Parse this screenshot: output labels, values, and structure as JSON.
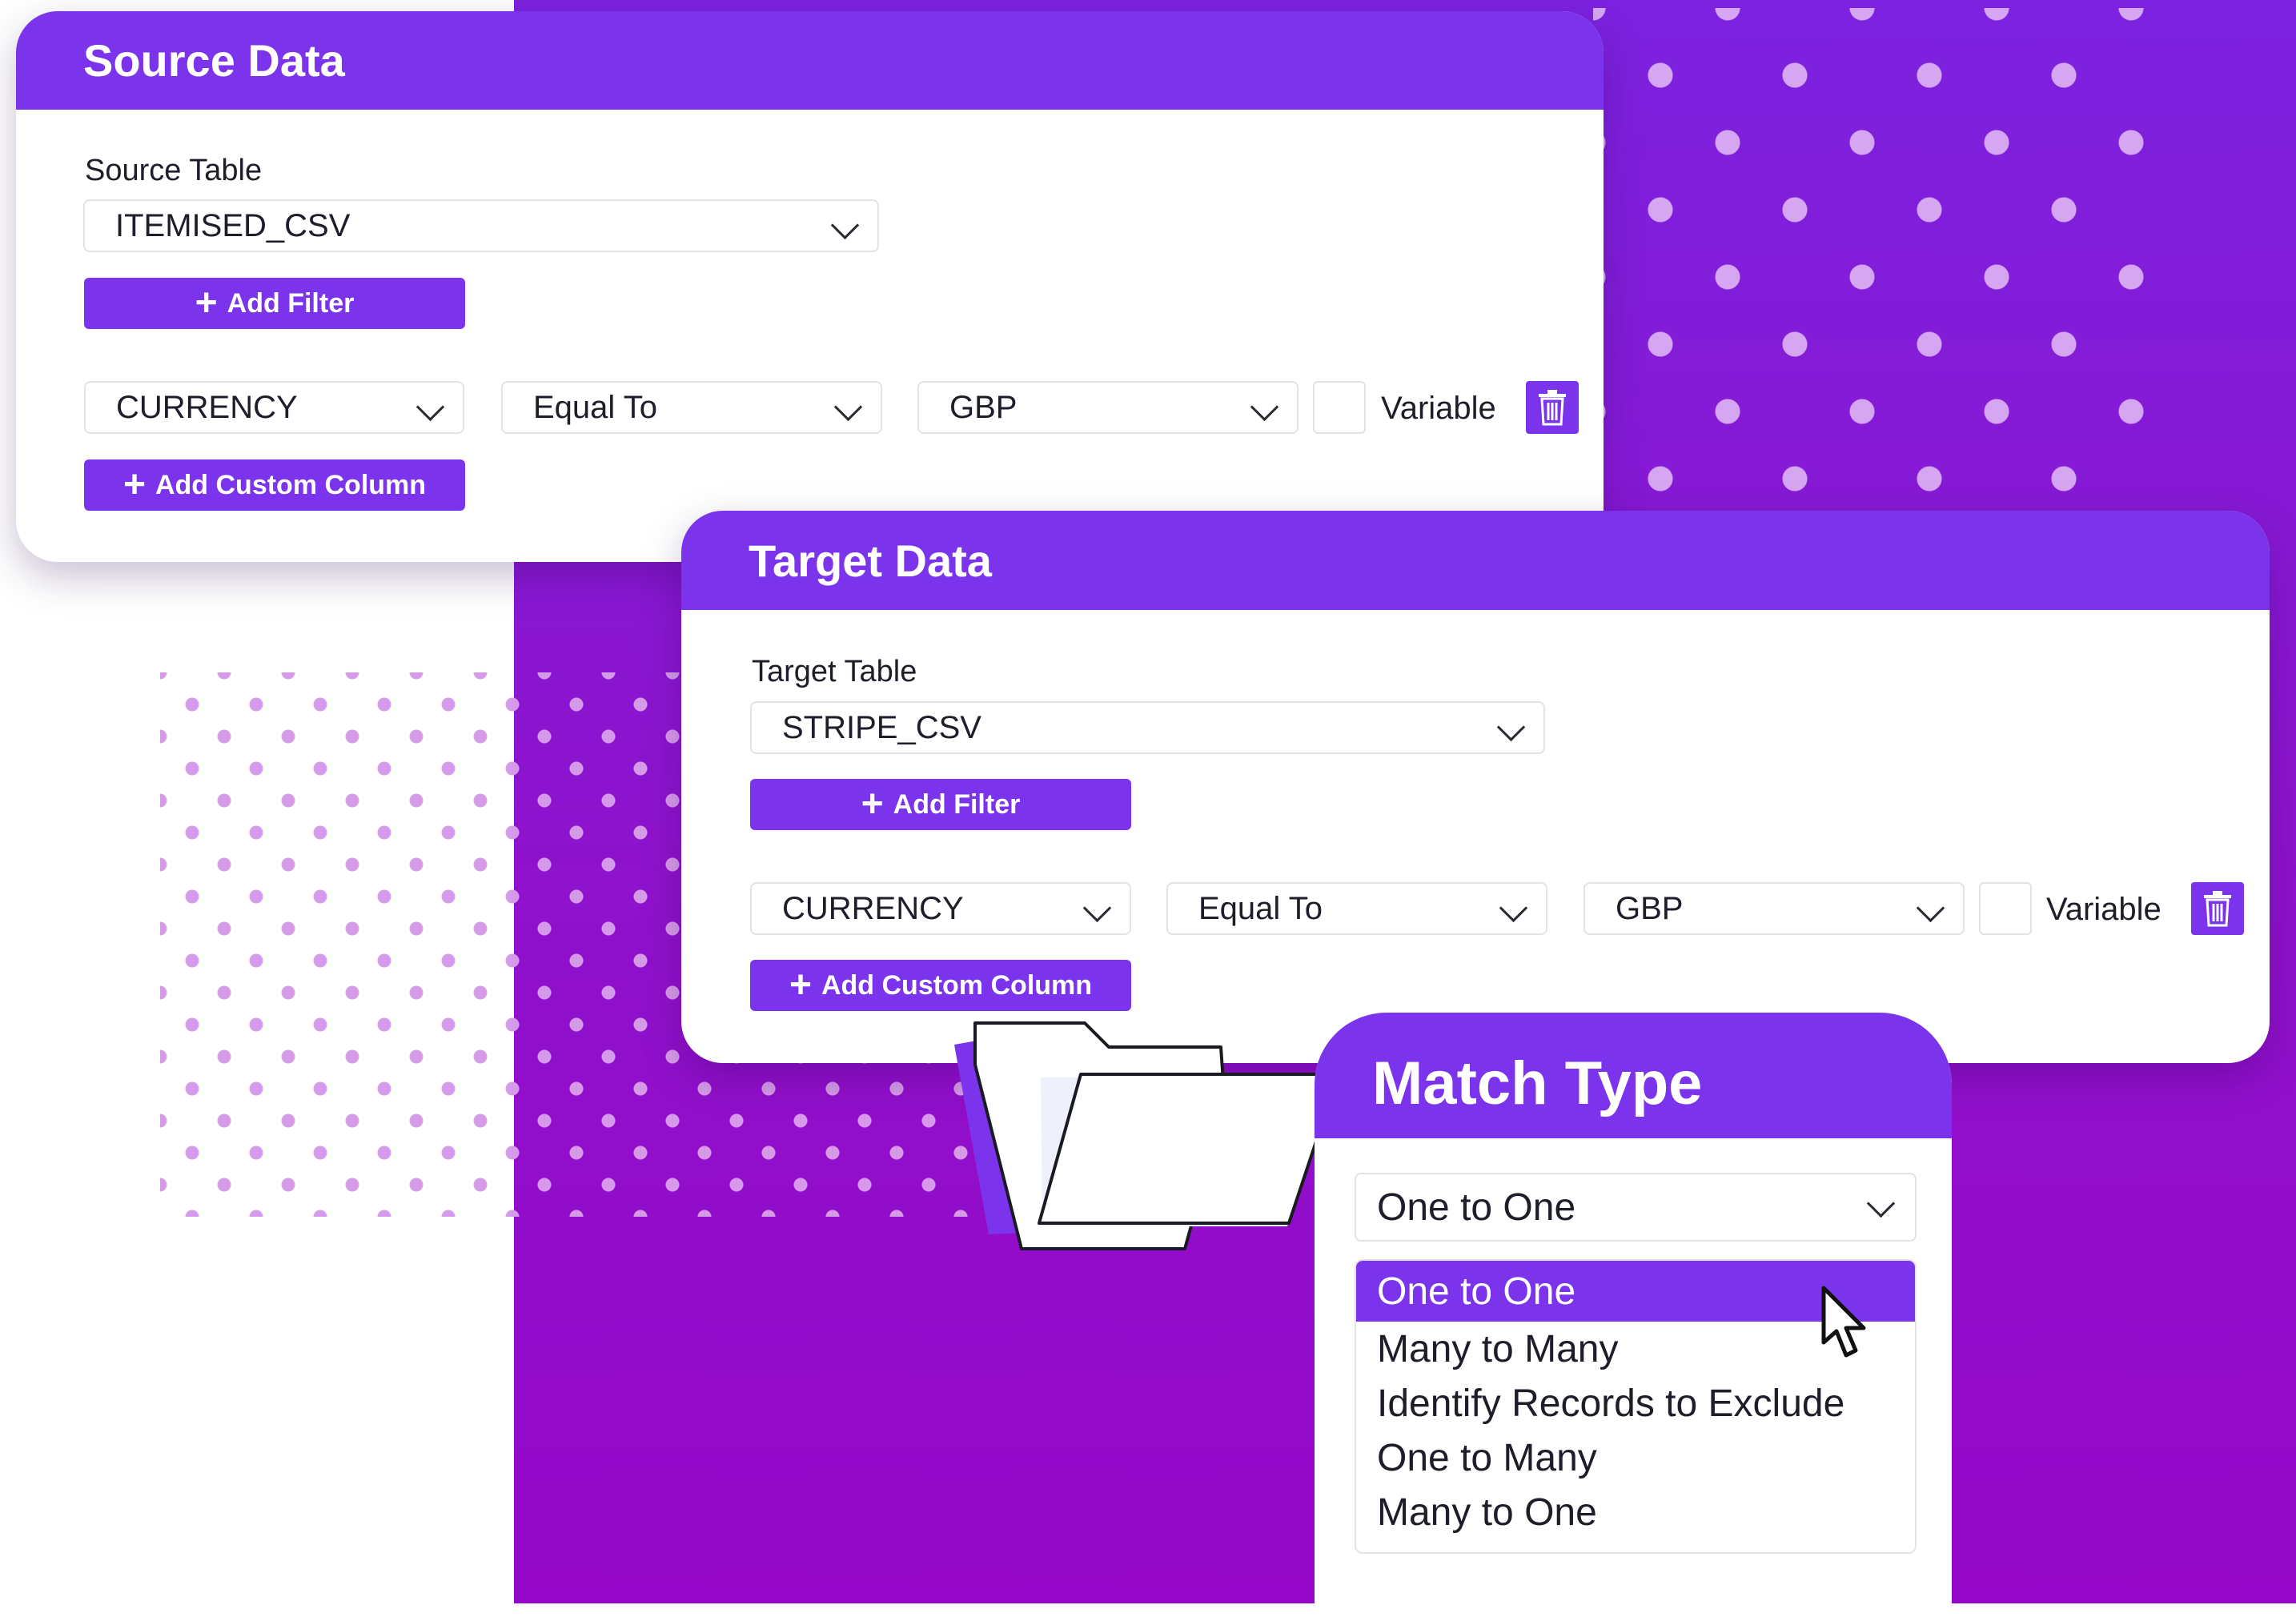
{
  "colors": {
    "accent": "#7b34ec",
    "background_purple": "#8f12cc",
    "dots": "#d7a6f2"
  },
  "source": {
    "title": "Source Data",
    "table_label": "Source Table",
    "table_value": "ITEMISED_CSV",
    "add_filter_label": "Add Filter",
    "filter": {
      "column": "CURRENCY",
      "operator": "Equal To",
      "value": "GBP",
      "variable_label": "Variable"
    },
    "add_custom_column_label": "Add Custom Column"
  },
  "target": {
    "title": "Target Data",
    "table_label": "Target Table",
    "table_value": "STRIPE_CSV",
    "add_filter_label": "Add Filter",
    "filter": {
      "column": "CURRENCY",
      "operator": "Equal To",
      "value": "GBP",
      "variable_label": "Variable"
    },
    "add_custom_column_label": "Add Custom Column"
  },
  "match_type": {
    "title": "Match Type",
    "selected": "One to One",
    "options": [
      "One to One",
      "Many to Many",
      "Identify Records to Exclude",
      "One to Many",
      "Many to One"
    ]
  },
  "icons": {
    "trash": "trash-icon",
    "plus": "plus-icon",
    "chevron": "chevron-down-icon",
    "folder": "folder-icon",
    "cursor": "cursor-arrow-icon"
  }
}
